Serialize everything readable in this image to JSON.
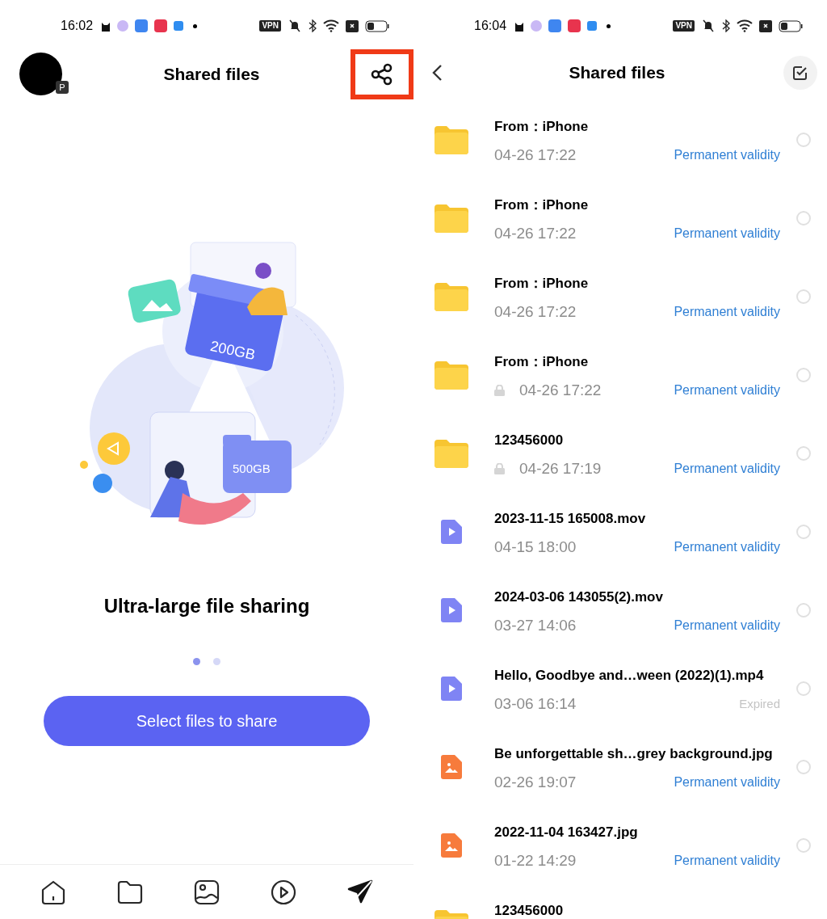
{
  "left_screen": {
    "status_bar": {
      "time": "16:02",
      "vpn": "VPN"
    },
    "header": {
      "avatar_badge": "P",
      "title": "Shared files",
      "share_highlighted": true
    },
    "illustration": {
      "card_label": "200GB",
      "folder_label": "500GB"
    },
    "feature_title": "Ultra-large file sharing",
    "pager": [
      {
        "selected": true
      },
      {
        "selected": false
      }
    ],
    "primary_button": "Select files to share",
    "bottom_nav": [
      {
        "kind": "home",
        "selected": false
      },
      {
        "kind": "folder",
        "selected": false
      },
      {
        "kind": "image",
        "selected": false
      },
      {
        "kind": "video",
        "selected": false
      },
      {
        "kind": "send",
        "selected": true
      }
    ]
  },
  "right_screen": {
    "status_bar": {
      "time": "16:04",
      "vpn": "VPN"
    },
    "header": {
      "title": "Shared files"
    },
    "files": [
      {
        "kind": "folder",
        "name": "From：iPhone",
        "locked": false,
        "date": "04-26 17:22",
        "validity": "Permanent validity",
        "expired": false,
        "selected": false
      },
      {
        "kind": "folder",
        "name": "From：iPhone",
        "locked": false,
        "date": "04-26 17:22",
        "validity": "Permanent validity",
        "expired": false,
        "selected": false
      },
      {
        "kind": "folder",
        "name": "From：iPhone",
        "locked": false,
        "date": "04-26 17:22",
        "validity": "Permanent validity",
        "expired": false,
        "selected": false
      },
      {
        "kind": "folder",
        "name": "From：iPhone",
        "locked": true,
        "date": "04-26 17:22",
        "validity": "Permanent validity",
        "expired": false,
        "selected": false
      },
      {
        "kind": "folder",
        "name": "123456000",
        "locked": true,
        "date": "04-26 17:19",
        "validity": "Permanent validity",
        "expired": false,
        "selected": false
      },
      {
        "kind": "video",
        "name": "2023-11-15 165008.mov",
        "locked": false,
        "date": "04-15 18:00",
        "validity": "Permanent validity",
        "expired": false,
        "selected": false
      },
      {
        "kind": "video",
        "name": "2024-03-06 143055(2).mov",
        "locked": false,
        "date": "03-27 14:06",
        "validity": "Permanent validity",
        "expired": false,
        "selected": false
      },
      {
        "kind": "video",
        "name": "Hello, Goodbye and…ween (2022)(1).mp4",
        "locked": false,
        "date": "03-06 16:14",
        "validity": "Expired",
        "expired": true,
        "selected": false
      },
      {
        "kind": "image",
        "name": "Be unforgettable sh…grey background.jpg",
        "locked": false,
        "date": "02-26 19:07",
        "validity": "Permanent validity",
        "expired": false,
        "selected": false
      },
      {
        "kind": "image",
        "name": "2022-11-04 163427.jpg",
        "locked": false,
        "date": "01-22 14:29",
        "validity": "Permanent validity",
        "expired": false,
        "selected": false
      },
      {
        "kind": "folder",
        "name": "123456000"
      }
    ]
  }
}
